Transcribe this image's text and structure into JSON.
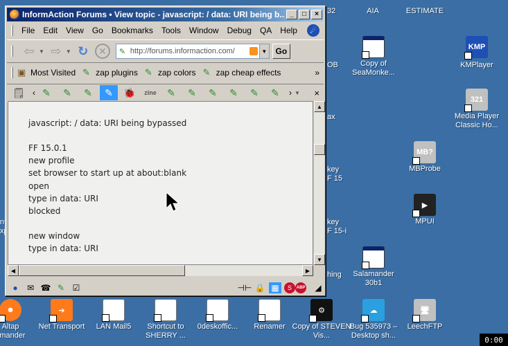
{
  "window": {
    "title": "InformAction Forums • View topic - javascript: / data: URI being b...",
    "buttons": {
      "minimize": "_",
      "maximize": "□",
      "close": "×"
    }
  },
  "menu": [
    "File",
    "Edit",
    "View",
    "Go",
    "Bookmarks",
    "Tools",
    "Window",
    "Debug",
    "QA",
    "Help"
  ],
  "navigation": {
    "url": "http://forums.informaction.com/",
    "go_label": "Go"
  },
  "bookmarks": [
    {
      "label": "Most Visited",
      "icon": "folder-icon"
    },
    {
      "label": "zap plugins",
      "icon": "wand-icon"
    },
    {
      "label": "zap colors",
      "icon": "wand-icon"
    },
    {
      "label": "zap cheap effects",
      "icon": "wand-icon"
    }
  ],
  "bookmarks_overflow": "»",
  "zapbar": {
    "zine_label": "zine",
    "close": "×"
  },
  "content": {
    "lines": [
      "javascript: / data: URI being bypassed",
      "FF 15.0.1",
      "new profile",
      "set browser to start up at about:blank",
      "open",
      "type in data: URI",
      "blocked",
      "new window",
      "type in data: URI"
    ]
  },
  "desktop": {
    "top_labels": [
      "32",
      "AIA",
      "ESTIMATE"
    ],
    "edge_labels": [
      "OB",
      "ax",
      "key",
      "F 15",
      "key",
      "F 15-i",
      "hing",
      "nt",
      "xp"
    ],
    "icons": [
      {
        "label": "Copy of SeaMonke...",
        "icon": "window-shortcut-icon"
      },
      {
        "label": "KMPlayer",
        "icon": "kmplayer-icon"
      },
      {
        "label": "Media Player Classic Ho...",
        "icon": "media-player-icon"
      },
      {
        "label": "MBProbe",
        "icon": "mbprobe-icon"
      },
      {
        "label": "MPUI",
        "icon": "mpui-icon"
      },
      {
        "label": "Salamander 30b1",
        "icon": "window-shortcut-icon"
      }
    ],
    "bottom_icons": [
      {
        "label": "Altap Salamander",
        "display": "Altap\namander"
      },
      {
        "label": "Net Transport"
      },
      {
        "label": "LAN Mail5"
      },
      {
        "label": "Shortcut to SHERRY ..."
      },
      {
        "label": "0deskoffic..."
      },
      {
        "label": "Renamer"
      },
      {
        "label": "Copy of STEVEN Vis..."
      },
      {
        "label": "Bug 535973 – Desktop sh..."
      },
      {
        "label": "LeechFTP"
      }
    ]
  },
  "clock": "0:00",
  "colors": {
    "desktop": "#3a6ea5",
    "titlebar": "#0a246a",
    "selected": "#3399ff"
  }
}
